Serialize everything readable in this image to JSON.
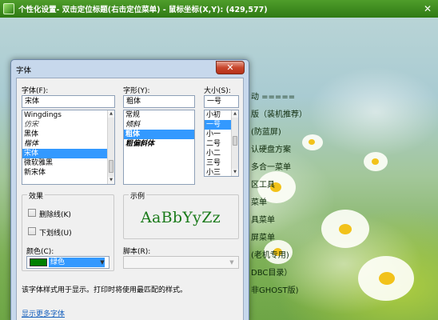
{
  "app": {
    "title": "个性化设置- 双击定位标题(右击定位菜单) - 鼠标坐标(X,Y): (429,577)",
    "close_label": "✕"
  },
  "background_menu": [
    "动 =====",
    "版（装机推荐）",
    "(防蓝屏)",
    "认硬盘方案",
    "多合一菜单",
    "区工具",
    "菜单",
    "具菜单",
    "屏菜单",
    "(老机专用)",
    "DBC目录）",
    "非GHOST版)"
  ],
  "dialog": {
    "title": "字体",
    "close_label": "✕",
    "font": {
      "label": "字体(F):",
      "value": "宋体",
      "items": [
        {
          "text": "Wingdings",
          "style": "normal",
          "selected": false
        },
        {
          "text": "仿宋",
          "style": "script",
          "selected": false
        },
        {
          "text": "黑体",
          "style": "normal",
          "selected": false
        },
        {
          "text": "楷体",
          "style": "kai",
          "selected": false
        },
        {
          "text": "宋体",
          "style": "normal",
          "selected": true
        },
        {
          "text": "微软雅黑",
          "style": "normal",
          "selected": false
        },
        {
          "text": "新宋体",
          "style": "normal",
          "selected": false
        }
      ]
    },
    "style": {
      "label": "字形(Y):",
      "value": "粗体",
      "items": [
        {
          "text": "常规",
          "style": "normal",
          "selected": false
        },
        {
          "text": "倾斜",
          "style": "kai",
          "selected": false
        },
        {
          "text": "粗体",
          "style": "bold",
          "selected": true
        },
        {
          "text": "粗偏斜体",
          "style": "bolditalic",
          "selected": false
        }
      ]
    },
    "size": {
      "label": "大小(S):",
      "value": "一号",
      "items": [
        {
          "text": "小初",
          "selected": false
        },
        {
          "text": "一号",
          "selected": true
        },
        {
          "text": "小一",
          "selected": false
        },
        {
          "text": "二号",
          "selected": false
        },
        {
          "text": "小二",
          "selected": false
        },
        {
          "text": "三号",
          "selected": false
        },
        {
          "text": "小三",
          "selected": false
        }
      ]
    },
    "effects": {
      "title": "效果",
      "strikeout": "删除线(K)",
      "underline": "下划线(U)",
      "color_label": "颜色(C):",
      "color_value": "绿色",
      "color_hex": "#008000"
    },
    "sample": {
      "title": "示例",
      "text": "AaBbYyZz",
      "script_label": "脚本(R):"
    },
    "note": "该字体样式用于显示。打印时将使用最匹配的样式。",
    "more_fonts": "显示更多字体"
  }
}
